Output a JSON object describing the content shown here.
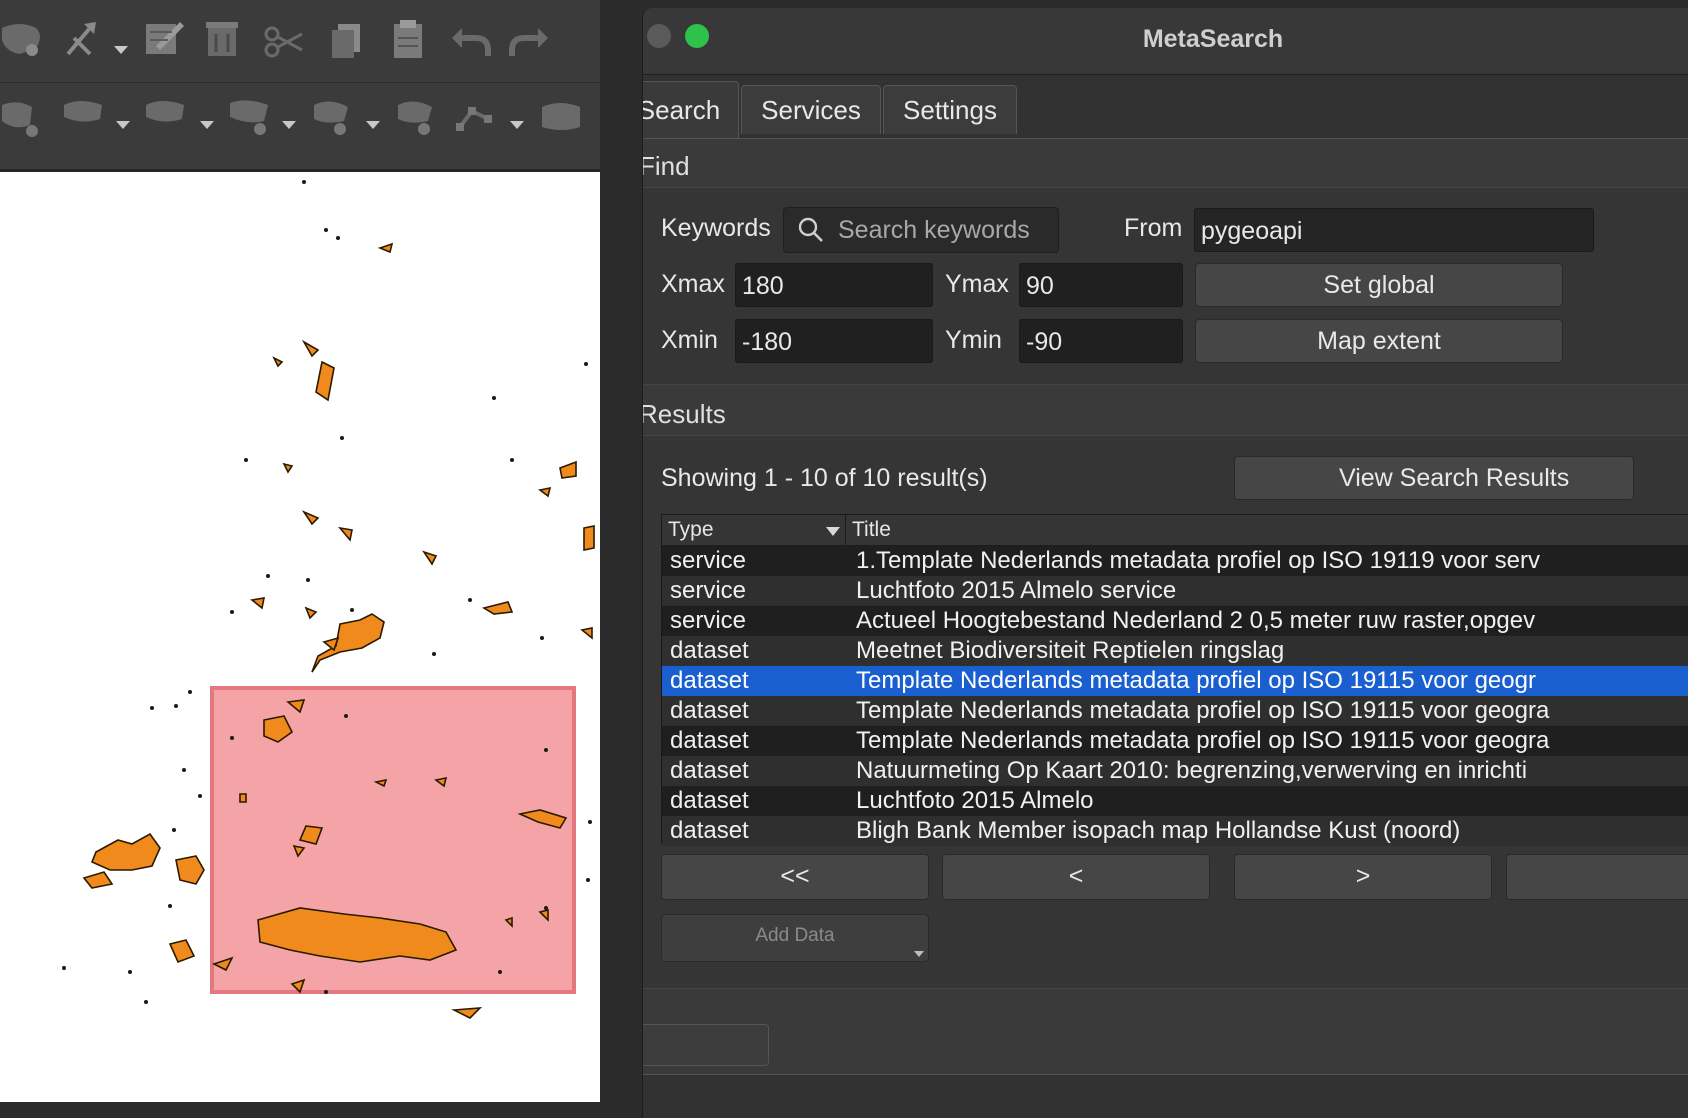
{
  "window": {
    "title": "MetaSearch"
  },
  "tabs": [
    {
      "label": "Search",
      "active": true
    },
    {
      "label": "Services",
      "active": false
    },
    {
      "label": "Settings",
      "active": false
    }
  ],
  "find": {
    "section_label": "Find",
    "keywords_label": "Keywords",
    "keywords_placeholder": "Search keywords",
    "from_label": "From",
    "from_value": "pygeoapi",
    "xmax_label": "Xmax",
    "xmax_value": "180",
    "ymax_label": "Ymax",
    "ymax_value": "90",
    "xmin_label": "Xmin",
    "xmin_value": "-180",
    "ymin_label": "Ymin",
    "ymin_value": "-90",
    "set_global_label": "Set global",
    "map_extent_label": "Map extent"
  },
  "results": {
    "section_label": "Results",
    "summary": "Showing 1 - 10 of 10 result(s)",
    "view_button_label": "View Search Results",
    "columns": [
      "Type",
      "Title"
    ],
    "rows": [
      {
        "type": "service",
        "title": "1.Template Nederlands metadata profiel op ISO 19119 voor serv"
      },
      {
        "type": "service",
        "title": "Luchtfoto 2015 Almelo service"
      },
      {
        "type": "service",
        "title": "Actueel Hoogtebestand Nederland 2 0,5 meter ruw raster,opgev"
      },
      {
        "type": "dataset",
        "title": "Meetnet Biodiversiteit Reptielen ringslag"
      },
      {
        "type": "dataset",
        "title": "Template Nederlands metadata profiel op ISO 19115 voor geogr",
        "selected": true
      },
      {
        "type": "dataset",
        "title": "Template Nederlands metadata profiel op ISO 19115 voor geogra"
      },
      {
        "type": "dataset",
        "title": "Template Nederlands metadata profiel op ISO 19115 voor geogra"
      },
      {
        "type": "dataset",
        "title": "Natuurmeting Op Kaart 2010: begrenzing,verwerving en inrichti"
      },
      {
        "type": "dataset",
        "title": "Luchtfoto 2015 Almelo"
      },
      {
        "type": "dataset",
        "title": "Bligh Bank Member isopach map Hollandse Kust (noord)"
      }
    ],
    "nav": {
      "first": "<<",
      "prev": "<",
      "next": ">"
    },
    "add_data_label": "Add Data"
  },
  "colors": {
    "selection": "#1a5fd0",
    "close_light": "#ed5f56",
    "zoom_light": "#2dc24a",
    "extent_box": "#f4a3a6",
    "features": "#f08a1c"
  },
  "toolbar_icons": [
    "digitize-icon",
    "edit-pencil-icon",
    "edit-table-icon",
    "delete-icon",
    "cut-icon",
    "copy-icon",
    "paste-icon",
    "undo-icon",
    "redo-icon"
  ]
}
